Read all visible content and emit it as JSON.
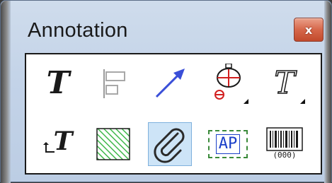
{
  "window": {
    "title": "Annotation",
    "close_symbol": "x"
  },
  "tools": [
    {
      "name": "text-tool-icon",
      "glyph": "T"
    },
    {
      "name": "align-tool-icon"
    },
    {
      "name": "arrow-tool-icon"
    },
    {
      "name": "stamp-point-tool-icon"
    },
    {
      "name": "text-style-tool-icon",
      "glyph": "T"
    },
    {
      "name": "callout-text-tool-icon",
      "glyph": "T"
    },
    {
      "name": "hatch-fill-tool-icon"
    },
    {
      "name": "paperclip-attachment-icon",
      "selected": true
    },
    {
      "name": "label-ap-tool-icon",
      "glyph": "AP"
    },
    {
      "name": "barcode-tool-icon",
      "glyph": "(000)"
    }
  ],
  "colors": {
    "arrow": "#3a4fd8",
    "hatch": "#3fb84a",
    "stamp_red": "#d21f1f",
    "label_blue": "#1a3fc8",
    "selected_bg": "#cde4f7"
  }
}
